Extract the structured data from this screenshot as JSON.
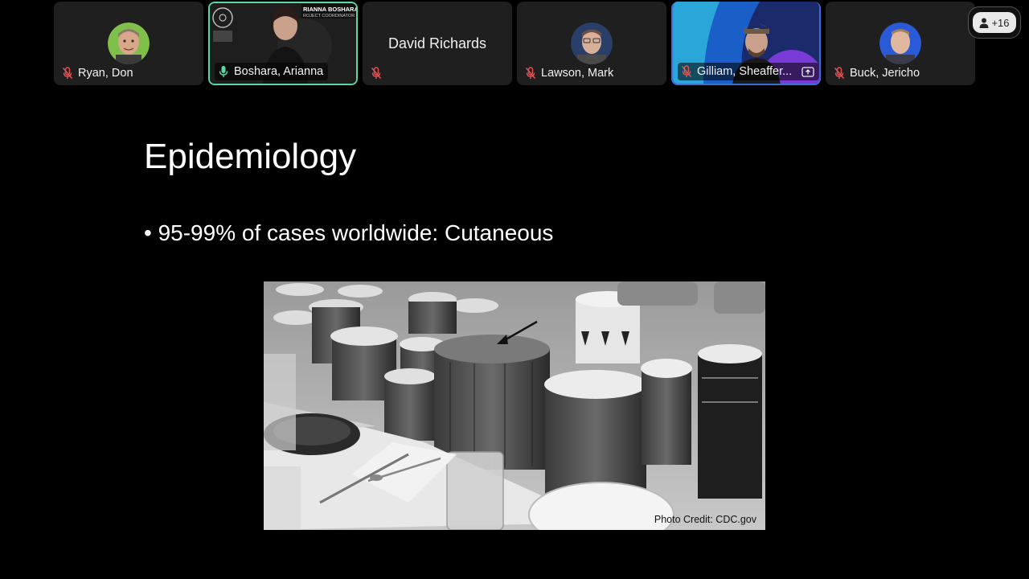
{
  "participants": [
    {
      "name": "Ryan, Don"
    },
    {
      "name": "Boshara, Arianna",
      "banner_name": "RIANNA BOSHARA",
      "banner_role": "ROJECT COORDINATOR"
    },
    {
      "name": "David Richards"
    },
    {
      "name": "Lawson, Mark"
    },
    {
      "name": "Gilliam, Sheaffer..."
    },
    {
      "name": "Buck, Jericho"
    }
  ],
  "people_count": "+16",
  "slide": {
    "title": "Epidemiology",
    "bullet": "• 95-99% of cases worldwide: Cutaneous",
    "photo_credit": "Photo Credit: CDC.gov"
  },
  "colors": {
    "active_speaker_border": "#5cd6a5",
    "muted_mic": "#e05555",
    "active_mic": "#5cd6a5",
    "tile_bg": "#1f1f1f"
  },
  "icons": {
    "mic_muted": "mic-muted-icon",
    "mic_active": "mic-icon",
    "screen_share": "screen-share-icon",
    "people": "person-icon"
  }
}
